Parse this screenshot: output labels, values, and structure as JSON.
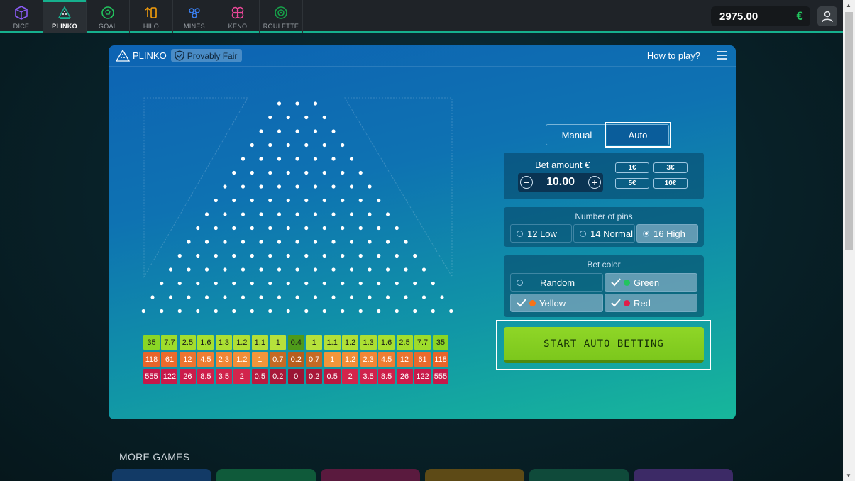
{
  "nav": {
    "tabs": [
      {
        "label": "DICE",
        "icon": "dice-icon",
        "color": "#8b5cf6"
      },
      {
        "label": "PLINKO",
        "icon": "plinko-icon",
        "color": "#16b08e",
        "active": true
      },
      {
        "label": "GOAL",
        "icon": "goal-icon",
        "color": "#22c55e"
      },
      {
        "label": "HILO",
        "icon": "hilo-icon",
        "color": "#f59e0b"
      },
      {
        "label": "MINES",
        "icon": "mines-icon",
        "color": "#3b82f6"
      },
      {
        "label": "KENO",
        "icon": "keno-icon",
        "color": "#ec4899"
      },
      {
        "label": "ROULETTE",
        "icon": "roulette-icon",
        "color": "#16a34a"
      }
    ],
    "balance": "2975.00",
    "currency": "€"
  },
  "panel": {
    "title": "PLINKO",
    "fair_label": "Provably Fair",
    "howto": "How to play?"
  },
  "multipliers": {
    "green": [
      "35",
      "7.7",
      "2.5",
      "1.6",
      "1.3",
      "1.2",
      "1.1",
      "1",
      "0.4",
      "1",
      "1.1",
      "1.2",
      "1.3",
      "1.6",
      "2.5",
      "7.7",
      "35"
    ],
    "yellow": [
      "118",
      "61",
      "12",
      "4.5",
      "2.3",
      "1.2",
      "1",
      "0.7",
      "0.2",
      "0.7",
      "1",
      "1.2",
      "2.3",
      "4.5",
      "12",
      "61",
      "118"
    ],
    "red": [
      "555",
      "122",
      "26",
      "8.5",
      "3.5",
      "2",
      "0.5",
      "0.2",
      "0",
      "0.2",
      "0.5",
      "2",
      "3.5",
      "8.5",
      "26",
      "122",
      "555"
    ]
  },
  "controls": {
    "mode": {
      "manual": "Manual",
      "auto": "Auto",
      "selected": "Auto"
    },
    "bet": {
      "label": "Bet amount €",
      "value": "10.00",
      "minus": "−",
      "plus": "+",
      "chips": [
        "1€",
        "3€",
        "5€",
        "10€"
      ]
    },
    "pins": {
      "title": "Number of pins",
      "options": [
        "12 Low",
        "14 Normal",
        "16 High"
      ],
      "selected": "16 High"
    },
    "color": {
      "title": "Bet color",
      "options": [
        {
          "label": "Random",
          "checked": false,
          "dot": ""
        },
        {
          "label": "Green",
          "checked": true,
          "dot": "#22c55e"
        },
        {
          "label": "Yellow",
          "checked": true,
          "dot": "#f97316"
        },
        {
          "label": "Red",
          "checked": true,
          "dot": "#e11d48"
        }
      ]
    },
    "start": "START AUTO BETTING"
  },
  "more_games": {
    "title": "MORE GAMES"
  },
  "colors": {
    "accent": "#16b08e",
    "start_button": "#84cc16"
  }
}
